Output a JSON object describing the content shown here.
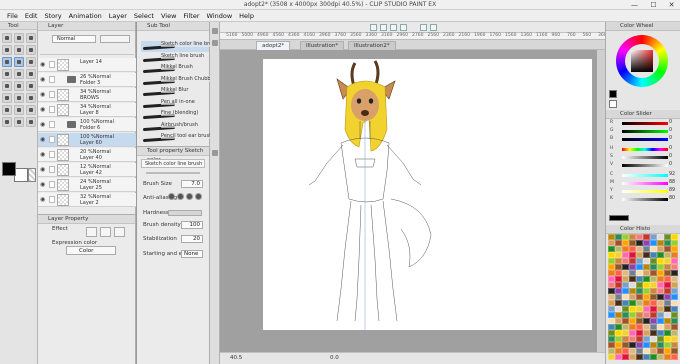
{
  "titlebar": {
    "title": "adopt2* (3508 x 4000px 300dpi 40.5%) - CLIP STUDIO PAINT EX",
    "minimize": "—",
    "maximize": "☐",
    "close": "✕"
  },
  "menu": [
    "File",
    "Edit",
    "Story",
    "Animation",
    "Layer",
    "Select",
    "View",
    "Filter",
    "Window",
    "Help"
  ],
  "tool_panel": {
    "title": "Tool"
  },
  "layer_panel": {
    "title": "Layer",
    "blend_mode": "Normal",
    "layers": [
      {
        "line1": "Layer 14",
        "line2": ""
      },
      {
        "line1": "26 %Normal",
        "line2": "Folder 3"
      },
      {
        "line1": "34 %Normal",
        "line2": "BROWS"
      },
      {
        "line1": "34 %Normal",
        "line2": "Layer 8"
      },
      {
        "line1": "100 %Normal",
        "line2": "Folder 6"
      },
      {
        "line1": "100 %Normal",
        "line2": "Layer 60"
      },
      {
        "line1": "20 %Normal",
        "line2": "Layer 40"
      },
      {
        "line1": "12 %Normal",
        "line2": "Layer 42"
      },
      {
        "line1": "24 %Normal",
        "line2": "Layer 25"
      },
      {
        "line1": "32 %Normal",
        "line2": "Layer 2"
      }
    ]
  },
  "layer_property": {
    "title": "Layer Property",
    "effect_label": "Effect",
    "expression_label": "Expression color",
    "expression_value": "Color"
  },
  "subtool_panel": {
    "title": "Sub Tool",
    "brushes": [
      "Sketch color line brush",
      "Sketch line brush",
      "Mikkel Brush",
      "Mikkel Brush Chubby",
      "Mikkel Blur",
      "Pen all in-one",
      "Fine (blending)",
      "Airbrush/brush",
      "Pencil tool ear brush"
    ]
  },
  "tool_property": {
    "title": "Tool property Sketch color",
    "brush_name": "Sketch color line brush",
    "rows": [
      {
        "label": "Brush Size",
        "value": "7.0"
      },
      {
        "label": "Anti-aliasing",
        "value": ""
      },
      {
        "label": "Hardness",
        "value": ""
      },
      {
        "label": "Brush density",
        "value": "100"
      },
      {
        "label": "Stabilization",
        "value": "20"
      },
      {
        "label": "Starting and ending",
        "value": "None"
      }
    ]
  },
  "canvas": {
    "tabs": [
      "adopt2*",
      "Illustration*",
      "Illustration2*"
    ],
    "ruler_ticks": [
      "5160",
      "5000",
      "4960",
      "4560",
      "4360",
      "4160",
      "3960",
      "3760",
      "3560",
      "3360",
      "3160",
      "2960",
      "2760",
      "2560",
      "2360",
      "2160",
      "1960",
      "1760",
      "1560",
      "1360",
      "1160",
      "960",
      "760",
      "560",
      "360"
    ],
    "status": [
      "40.5",
      "0.0"
    ]
  },
  "right_panel": {
    "color_wheel_title": "Color Wheel",
    "color_slider_title": "Color Slider",
    "color_history_title": "Color Histo",
    "rgb_labels": [
      "R",
      "G",
      "B"
    ],
    "hsv_labels": [
      "H",
      "S",
      "V"
    ],
    "rgb_values": [
      "0",
      "0",
      "0"
    ],
    "hsv_values": [
      "0",
      "0",
      "0"
    ],
    "cmyk_labels": [
      "C",
      "M",
      "Y",
      "K"
    ],
    "cmyk_values": [
      "92",
      "88",
      "89",
      "80"
    ]
  },
  "colors": {
    "selected_layer": "#c5d9ef",
    "accent": "#6f97c5",
    "main_color": "#000000",
    "sub_color": "#ffffff"
  }
}
